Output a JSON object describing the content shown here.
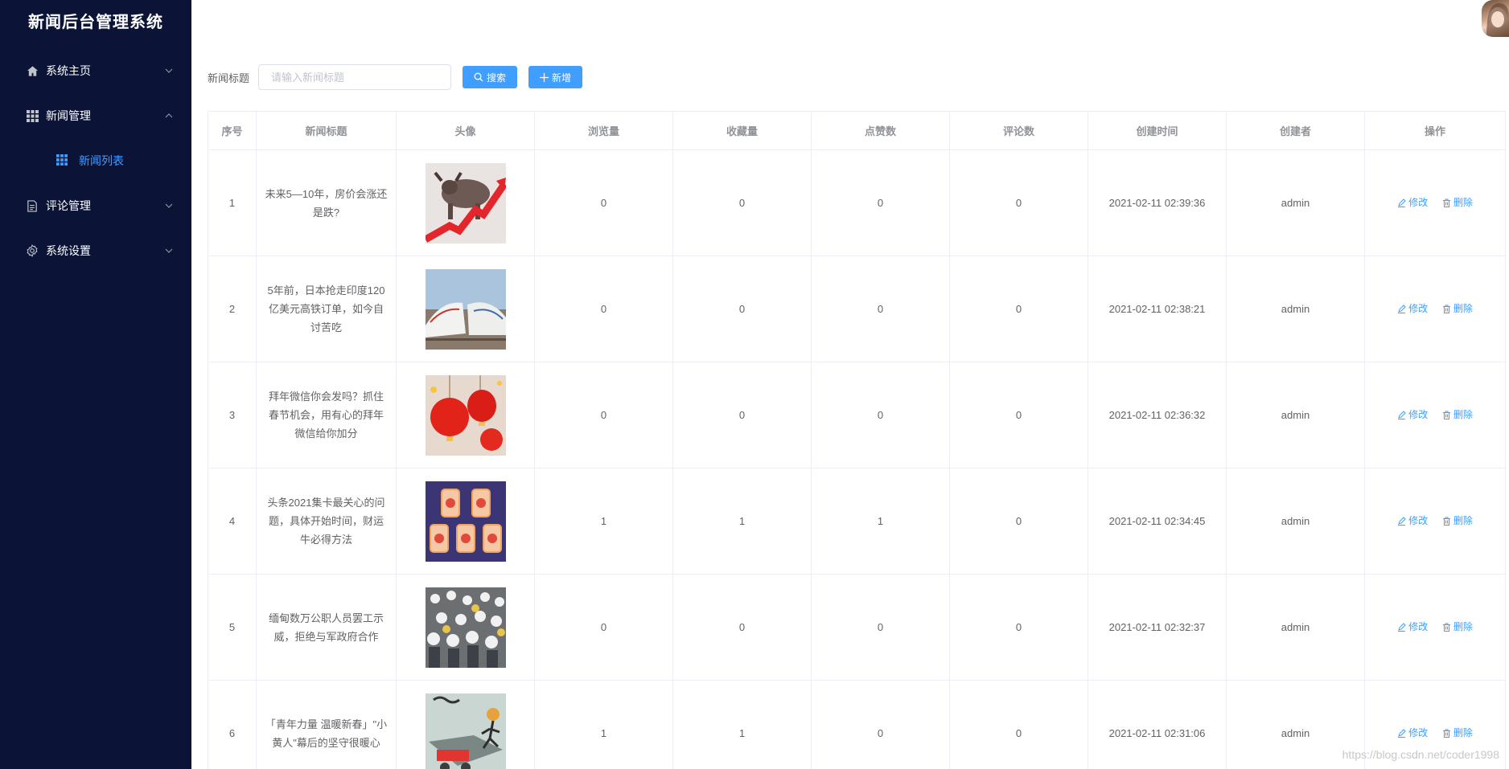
{
  "app": {
    "title": "新闻后台管理系统"
  },
  "sidebar": {
    "items": [
      {
        "label": "系统主页",
        "icon": "home-icon",
        "expanded": false
      },
      {
        "label": "新闻管理",
        "icon": "grid-icon",
        "expanded": true,
        "children": [
          {
            "label": "新闻列表",
            "icon": "grid-icon",
            "active": true
          }
        ]
      },
      {
        "label": "评论管理",
        "icon": "document-icon",
        "expanded": false
      },
      {
        "label": "系统设置",
        "icon": "gear-icon",
        "expanded": false
      }
    ]
  },
  "search": {
    "label": "新闻标题",
    "placeholder": "请输入新闻标题",
    "value": "",
    "search_button": "搜索",
    "add_button": "新增"
  },
  "table": {
    "columns": [
      "序号",
      "新闻标题",
      "头像",
      "浏览量",
      "收藏量",
      "点赞数",
      "评论数",
      "创建时间",
      "创建者",
      "操作"
    ],
    "actions": {
      "edit": "修改",
      "delete": "删除"
    },
    "rows": [
      {
        "id": "1",
        "title": "未来5—10年，房价会涨还是跌?",
        "thumb": "bull-stock-chart",
        "views": "0",
        "favorites": "0",
        "likes": "0",
        "comments": "0",
        "created": "2021-02-11 02:39:36",
        "creator": "admin"
      },
      {
        "id": "2",
        "title": "5年前，日本抢走印度120亿美元高铁订单，如今自讨苦吃",
        "thumb": "bullet-train",
        "views": "0",
        "favorites": "0",
        "likes": "0",
        "comments": "0",
        "created": "2021-02-11 02:38:21",
        "creator": "admin"
      },
      {
        "id": "3",
        "title": "拜年微信你会发吗？抓住春节机会，用有心的拜年微信给你加分",
        "thumb": "red-lanterns",
        "views": "0",
        "favorites": "0",
        "likes": "0",
        "comments": "0",
        "created": "2021-02-11 02:36:32",
        "creator": "admin"
      },
      {
        "id": "4",
        "title": "头条2021集卡最关心的问题，具体开始时间，财运牛必得方法",
        "thumb": "collect-cards",
        "views": "1",
        "favorites": "1",
        "likes": "1",
        "comments": "0",
        "created": "2021-02-11 02:34:45",
        "creator": "admin"
      },
      {
        "id": "5",
        "title": "缅甸数万公职人员罢工示威，拒绝与军政府合作",
        "thumb": "protest-crowd",
        "views": "0",
        "favorites": "0",
        "likes": "0",
        "comments": "0",
        "created": "2021-02-11 02:32:37",
        "creator": "admin"
      },
      {
        "id": "6",
        "title": "「青年力量 温暖新春」\"小黄人\"幕后的坚守很暖心",
        "thumb": "cartoon-poster",
        "views": "1",
        "favorites": "1",
        "likes": "0",
        "comments": "0",
        "created": "2021-02-11 02:31:06",
        "creator": "admin"
      }
    ]
  },
  "watermark": "https://blog.csdn.net/coder1998",
  "colors": {
    "sidebar_bg": "#0b1437",
    "accent": "#409eff",
    "border": "#ebeef5",
    "header_text": "#909399"
  }
}
